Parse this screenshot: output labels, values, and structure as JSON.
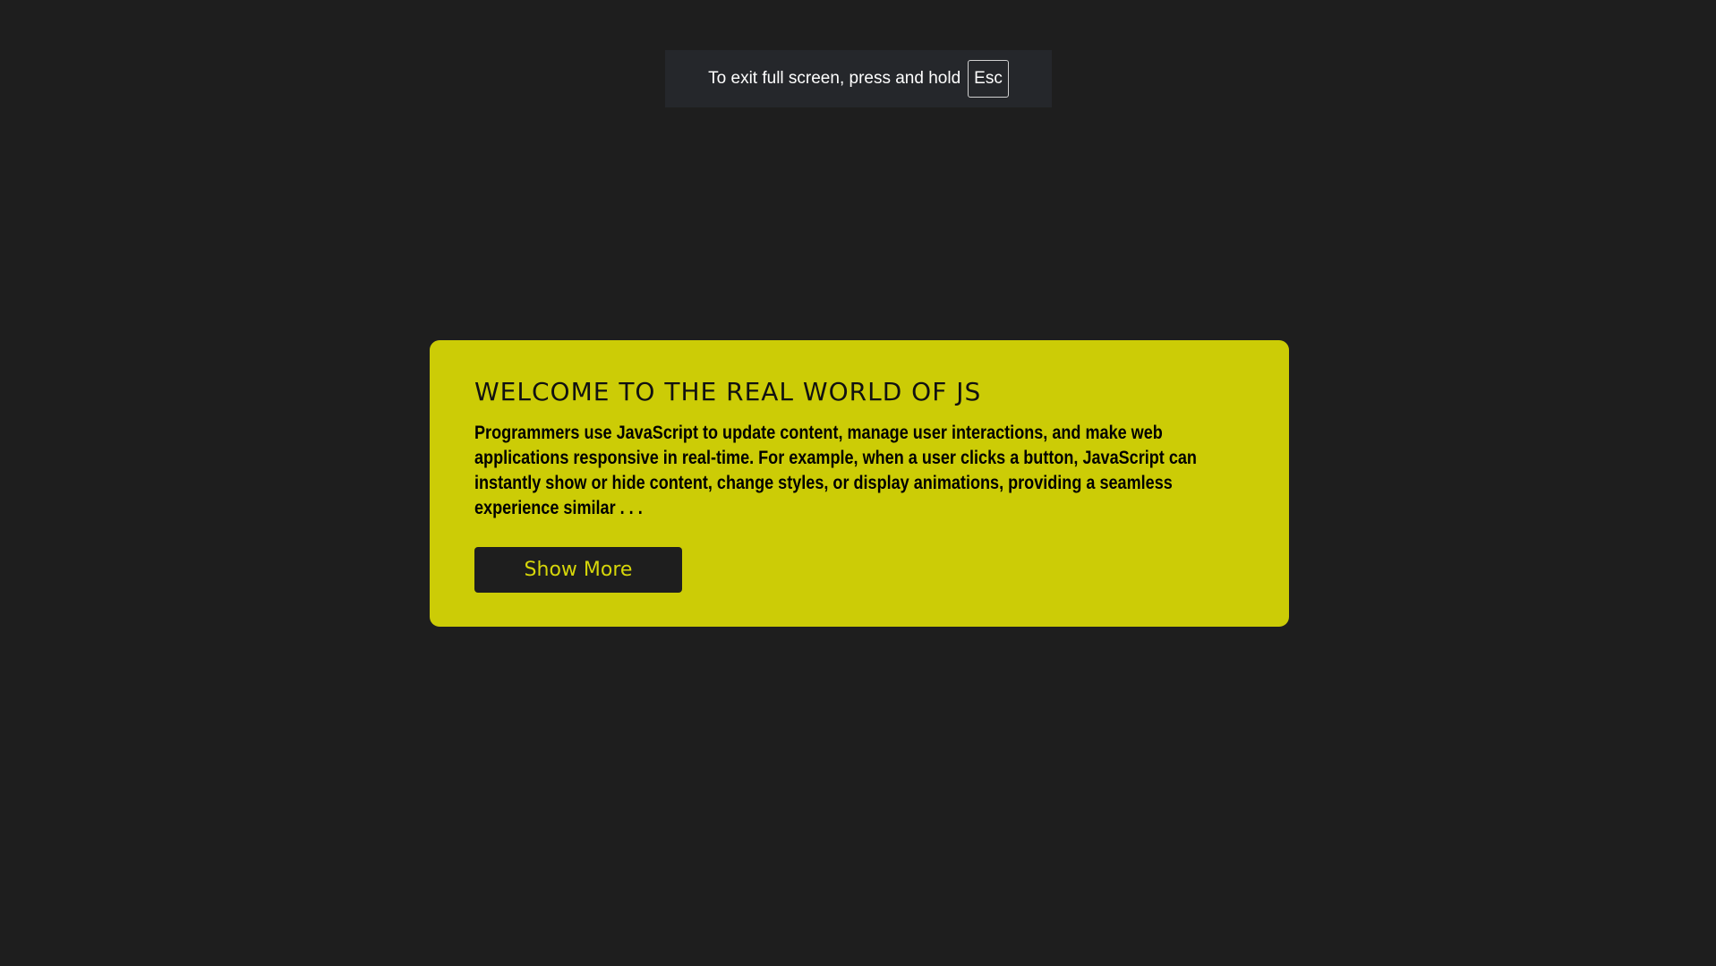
{
  "fullscreen_notice": {
    "text": "To exit full screen, press and hold",
    "key": "Esc"
  },
  "card": {
    "title": "WELCOME TO THE REAL WORLD OF JS",
    "body": "Programmers use JavaScript to update content, manage user interactions, and make web applications responsive in real-time. For example, when a user clicks a button, JavaScript can instantly show or hide content, change styles, or display animations, providing a seamless experience similar . . .",
    "button_label": "Show More"
  },
  "colors": {
    "page_background": "#1e1e1e",
    "card_background": "#cccc06",
    "button_background": "#1e1e1e",
    "button_text": "#d6d60a",
    "notice_background": "#25272b"
  }
}
